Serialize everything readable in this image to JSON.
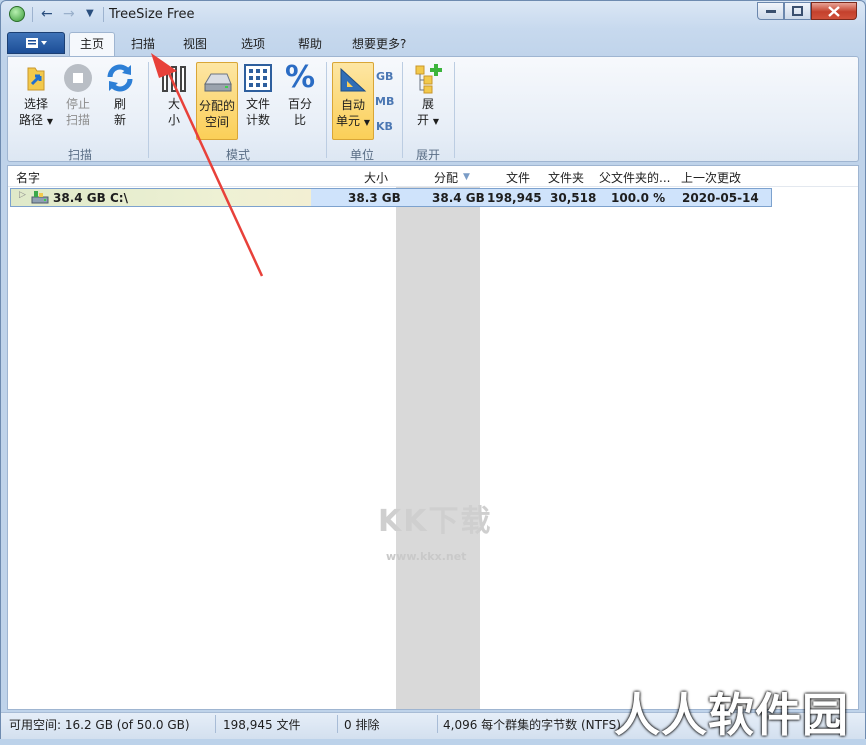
{
  "window": {
    "title": "TreeSize Free"
  },
  "tabs": [
    {
      "label": "主页"
    },
    {
      "label": "扫描"
    },
    {
      "label": "视图"
    },
    {
      "label": "选项"
    },
    {
      "label": "帮助"
    },
    {
      "label": "想要更多?"
    }
  ],
  "ribbon": {
    "scan_group": {
      "label": "扫描",
      "select_path_l1": "选择",
      "select_path_l2": "路径",
      "stop_scan_l1": "停止",
      "stop_scan_l2": "扫描",
      "refresh_l1": "刷",
      "refresh_l2": "新"
    },
    "mode_group": {
      "label": "模式",
      "size_l1": "大",
      "size_l2": "小",
      "allocated_l1": "分配的",
      "allocated_l2": "空间",
      "file_count_l1": "文件",
      "file_count_l2": "计数",
      "percent_l1": "百分",
      "percent_l2": "比"
    },
    "unit_group": {
      "label": "单位",
      "auto_l1": "自动",
      "auto_l2": "单元",
      "gb": "GB",
      "mb": "MB",
      "kb": "KB"
    },
    "expand_group": {
      "label": "展开",
      "expand_l1": "展",
      "expand_l2": "开"
    }
  },
  "columns": {
    "name": "名字",
    "size": "大小",
    "allocated": "分配",
    "files": "文件",
    "folders": "文件夹",
    "percent_parent": "父文件夹的...",
    "last_change": "上一次更改"
  },
  "rows": [
    {
      "name_size": "38.4 GB",
      "name_path": "C:\\",
      "size": "38.3 GB",
      "allocated": "38.4 GB",
      "files": "198,945",
      "folders": "30,518",
      "percent_parent": "100.0 %",
      "last_change": "2020-05-14"
    }
  ],
  "status": {
    "free_space": "可用空间: 16.2 GB  (of 50.0 GB)",
    "file_count": "198,945 文件",
    "excluded": "0 排除",
    "cluster": "4,096 每个群集的字节数 (NTFS)"
  },
  "watermarks": {
    "center_logo": "KK下载",
    "center_url": "www.kkx.net",
    "corner": "人人软件园"
  },
  "colors": {
    "accent": "#1c4e97",
    "selected_button": "#fbcf58",
    "row_highlight": "#cfe3fb",
    "sorted_column_shade": "#d9d9d9",
    "annotation_arrow": "#e8413a"
  }
}
